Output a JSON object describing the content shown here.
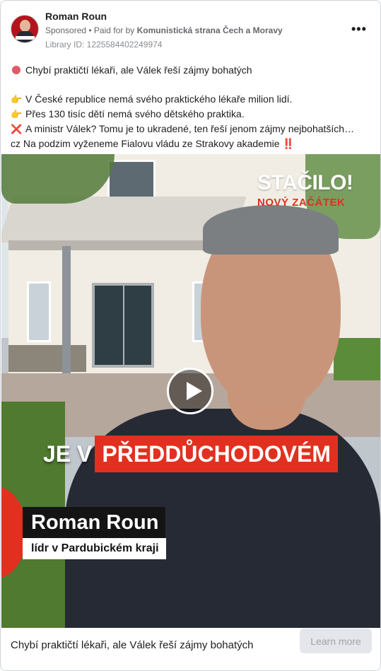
{
  "post": {
    "author": "Roman Roun",
    "sponsored": "Sponsored",
    "separator": " • ",
    "paid_for_prefix": "Paid for by ",
    "sponsor": "Komunistická strana Čech a Moravy",
    "library_id": "Library ID: 1225584402249974",
    "more_icon": "ellipsis-icon"
  },
  "body": {
    "lines": [
      "Chybí praktičtí lékaři, ale Válek řeší zájmy bohatých",
      "V České republice nemá svého praktického lékaře milion lidí.",
      "Přes 130 tisíc dětí nemá svého dětského praktika.",
      "A ministr Válek? Tomu je to ukradené, ten řeší jenom zájmy nejbohatších…",
      "cz Na podzim vyženeme Fialovu vládu ze Strakovy akademie"
    ],
    "icons": {
      "line0": "red-circle-icon",
      "line1": "👉",
      "line2": "👉",
      "line3": "❌",
      "line4_end": "‼️"
    }
  },
  "video": {
    "logo_title": "STAČILO!",
    "logo_subtitle": "NOVÝ ZAČÁTEK",
    "caption_white": "JE V",
    "caption_red": "PŘEDDŮCHODOVÉM",
    "person_name": "Roman Roun",
    "person_role": "lídr v Pardubickém kraji",
    "play_icon": "play-icon",
    "accent_color": "#e1301f"
  },
  "footer": {
    "headline": "Chybí praktičtí lékaři, ale Válek řeší zájmy bohatých",
    "cta": "Learn more"
  }
}
